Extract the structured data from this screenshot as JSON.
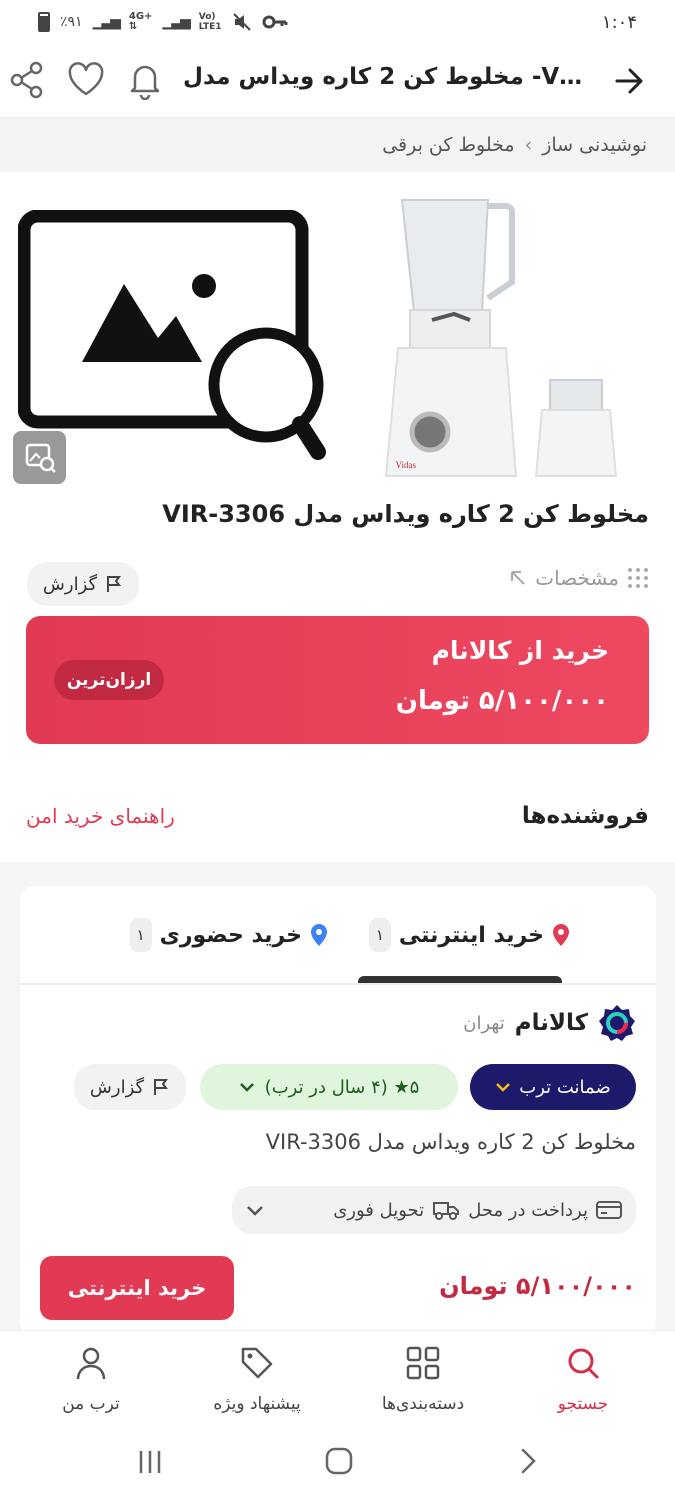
{
  "status": {
    "time": "۱:۰۴",
    "battery": "٪۹۱"
  },
  "topbar": {
    "title": "مخلوط کن 2 کاره ویداس مدل -VIR..."
  },
  "breadcrumb": {
    "item1": "نوشیدنی ساز",
    "sep": "›",
    "item2": "مخلوط کن برقی"
  },
  "product": {
    "title": "مخلوط کن 2 کاره ویداس مدل VIR-3306",
    "specs": "مشخصات",
    "report": "گزارش"
  },
  "buy": {
    "store": "خرید از کالانام",
    "price": "۵/۱۰۰/۰۰۰ تومان",
    "badge": "ارزان‌ترین"
  },
  "sellers": {
    "title": "فروشنده‌ها",
    "guide": "راهنمای خرید امن"
  },
  "tabs": [
    {
      "label": "خرید اینترنتی",
      "count": "۱"
    },
    {
      "label": "خرید حضوری",
      "count": "۱"
    }
  ],
  "seller": {
    "name": "کالانام",
    "city": "تهران",
    "guarantee": "ضمانت ترب",
    "rating": "۵★ (۴ سال در ترب)",
    "report": "گزارش",
    "product": "مخلوط کن 2 کاره ویداس مدل VIR-3306",
    "payment": "پرداخت در محل",
    "delivery": "تحویل فوری",
    "price": "۵/۱۰۰/۰۰۰ تومان",
    "buy_button": "خرید اینترنتی"
  },
  "nav": [
    {
      "label": "جستجو"
    },
    {
      "label": "دسته‌بندی‌ها"
    },
    {
      "label": "پیشنهاد ویژه"
    },
    {
      "label": "ترب من"
    }
  ],
  "image": {
    "brand": "Vidas"
  },
  "colors": {
    "accent": "#e23a55",
    "nav_active": "#d62d4a",
    "guarantee_bg": "#1d1a6b"
  }
}
